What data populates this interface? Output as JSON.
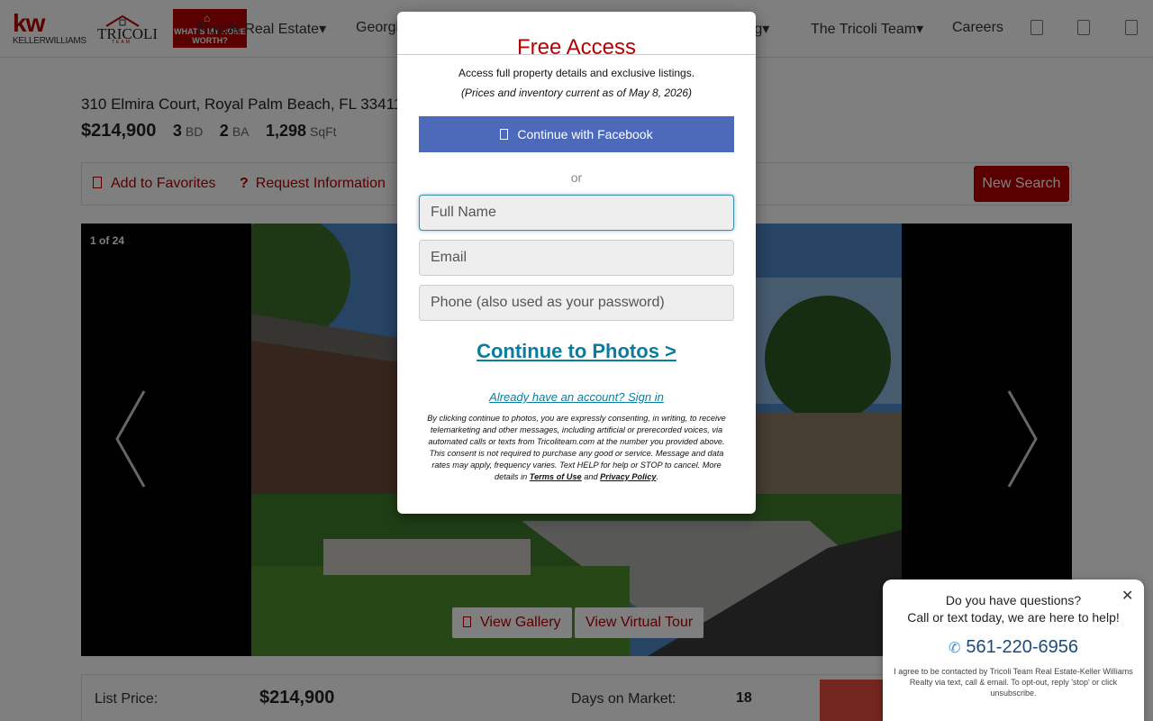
{
  "header": {
    "kw_logo": "kw",
    "kw_brand": "KELLERWILLIAMS",
    "tricoli_logo": "TRICOLI",
    "tricoli_team": "TEAM",
    "worth_badge": "WHAT'S MY HOME WORTH?",
    "nav": {
      "florida": "Florida Real Estate▾",
      "georgia": "Georgia",
      "listing": "Listing▾",
      "tricoli_team": "The Tricoli Team▾",
      "careers": "Careers"
    },
    "icons": [
      "phone-icon",
      "user-icon",
      "menu-icon"
    ]
  },
  "listing": {
    "address": "310 Elmira Court, Royal Palm Beach, FL 33411",
    "price": "$214,900",
    "beds": "3",
    "beds_unit": "BD",
    "baths": "2",
    "baths_unit": "BA",
    "sqft": "1,298",
    "sqft_unit": "SqFt"
  },
  "actions": {
    "favorites": "Add to Favorites",
    "request_info": "Request Information",
    "new_search": "New Search"
  },
  "gallery": {
    "counter": "1 of 24",
    "view_gallery": "View Gallery",
    "view_tour": "View Virtual Tour"
  },
  "details": {
    "list_price_label": "List Price:",
    "list_price": "$214,900",
    "days_label": "Days on Market:",
    "days": "18"
  },
  "modal": {
    "title": "Free Access",
    "subtitle": "Access full property details and exclusive listings.",
    "note": "(Prices and inventory current as of May 8, 2026)",
    "facebook_button": "Continue with Facebook",
    "or": "or",
    "full_name_placeholder": "Full Name",
    "email_placeholder": "Email",
    "phone_placeholder": "Phone (also used as your password)",
    "continue_link": "Continue to Photos >",
    "signin_link": "Already have an account? Sign in",
    "consent_text": "By clicking continue to photos, you are expressly consenting, in writing, to receive telemarketing and other messages, including artificial or prerecorded voices, via automated calls or texts from Tricoliteam.com at the number you provided above. This consent is not required to purchase any good or service. Message and data rates may apply, frequency varies. Text HELP for help or STOP to cancel. More details in",
    "terms_link": "Terms of Use",
    "and": "and",
    "privacy_link": "Privacy Policy",
    "period": "."
  },
  "chat": {
    "close": "✕",
    "question": "Do you have questions?",
    "subtitle": "Call or text today, we are here to help!",
    "phone": "561-220-6956",
    "disclaimer": "I agree to be contacted by Tricoli Team Real Estate-Keller Williams Realty via text, call & email. To opt-out, reply 'stop' or click unsubscribe."
  },
  "colors": {
    "brand_red": "#b40101",
    "facebook_blue": "#4d69b9",
    "link_teal": "#0a7d9c",
    "cta_orange": "#e74c3c"
  }
}
